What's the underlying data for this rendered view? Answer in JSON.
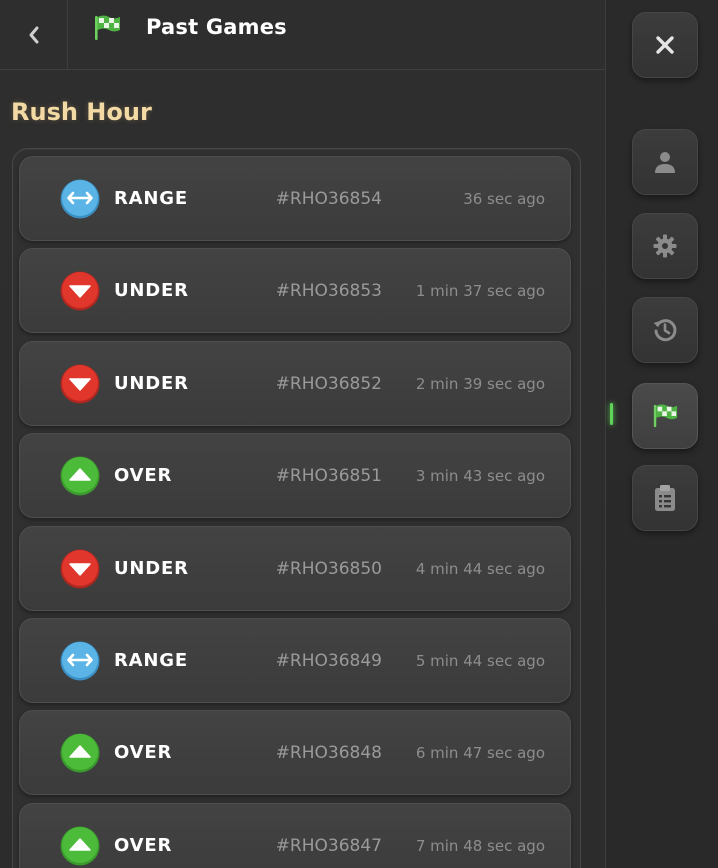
{
  "header": {
    "title": "Past Games"
  },
  "section": {
    "title": "Rush Hour"
  },
  "colors": {
    "range": "#5ab5e6",
    "under": "#e0362c",
    "over": "#4cbb3a",
    "title_accent": "#f3d9a4",
    "active_indicator": "#5fd35a"
  },
  "games": [
    {
      "type": "RANGE",
      "icon": "range-arrows-icon",
      "id": "#RHO36854",
      "time": "36 sec ago"
    },
    {
      "type": "UNDER",
      "icon": "down-triangle-icon",
      "id": "#RHO36853",
      "time": "1 min 37 sec ago"
    },
    {
      "type": "UNDER",
      "icon": "down-triangle-icon",
      "id": "#RHO36852",
      "time": "2 min 39 sec ago"
    },
    {
      "type": "OVER",
      "icon": "up-triangle-icon",
      "id": "#RHO36851",
      "time": "3 min 43 sec ago"
    },
    {
      "type": "UNDER",
      "icon": "down-triangle-icon",
      "id": "#RHO36850",
      "time": "4 min 44 sec ago"
    },
    {
      "type": "RANGE",
      "icon": "range-arrows-icon",
      "id": "#RHO36849",
      "time": "5 min 44 sec ago"
    },
    {
      "type": "OVER",
      "icon": "up-triangle-icon",
      "id": "#RHO36848",
      "time": "6 min 47 sec ago"
    },
    {
      "type": "OVER",
      "icon": "up-triangle-icon",
      "id": "#RHO36847",
      "time": "7 min 48 sec ago"
    }
  ],
  "sidebar": {
    "buttons": [
      {
        "name": "close",
        "icon": "close-icon"
      },
      {
        "name": "profile",
        "icon": "user-icon"
      },
      {
        "name": "settings",
        "icon": "gear-icon"
      },
      {
        "name": "history",
        "icon": "history-icon"
      },
      {
        "name": "past-games",
        "icon": "checkered-flag-icon",
        "active": true
      },
      {
        "name": "rules",
        "icon": "clipboard-icon"
      }
    ]
  }
}
